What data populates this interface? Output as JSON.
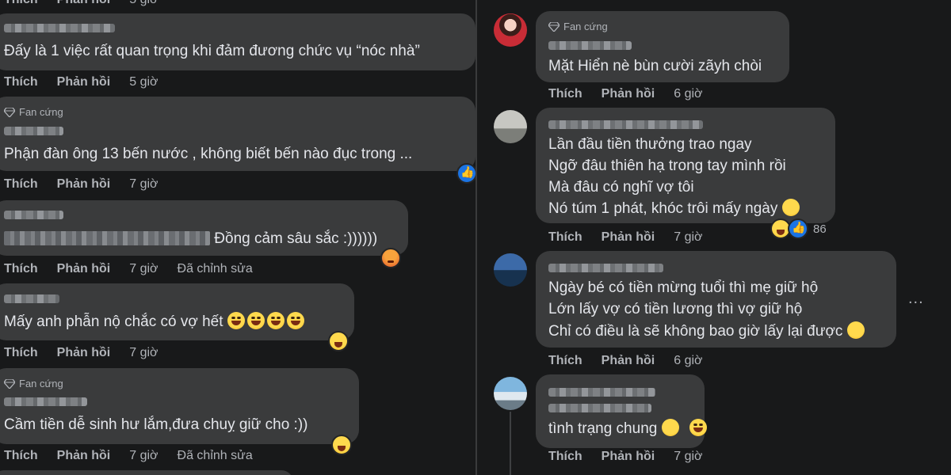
{
  "labels": {
    "like": "Thích",
    "reply": "Phản hồi",
    "edited": "Đã chỉnh sửa",
    "fan_badge": "Fan cứng"
  },
  "left": {
    "top_meta": {
      "time": "5 giờ"
    },
    "comments": [
      {
        "text": "Đấy là 1 việc rất quan trọng khi đảm đương chức vụ “nóc nhà”",
        "time": "5 giờ"
      },
      {
        "text": "Phận đàn ông 13 bến nước , không biết bến nào đục trong ...",
        "time": "7 giờ",
        "reaction": "like"
      },
      {
        "text": "Đồng cảm sâu sắc :))))))",
        "time": "7 giờ",
        "edited": true,
        "reaction": "angry"
      },
      {
        "text": "Mấy anh phẫn nộ chắc có vợ hết",
        "time": "7 giờ",
        "reaction": "haha"
      },
      {
        "text": "Cầm tiền dễ sinh hư lắm,đưa chuỵ giữ cho :))",
        "time": "7 giờ",
        "edited": true,
        "reaction": "haha"
      }
    ]
  },
  "right": {
    "comments": [
      {
        "lines": [
          "Mặt Hiển nè bùn cười zãyh chòi"
        ],
        "time": "6 giờ"
      },
      {
        "lines": [
          "Lần đầu tiền thưởng trao ngay",
          "Ngỡ đâu thiên hạ trong tay mình rồi",
          "Mà đâu có nghĩ vợ tôi",
          "Nó túm 1 phát, khóc trôi mấy ngày"
        ],
        "time": "7 giờ",
        "reaction_count": "86"
      },
      {
        "lines": [
          "Ngày bé có tiền mừng tuổi thì mẹ giữ hộ",
          "Lớn lấy vợ có tiền lương thì vợ giữ hộ",
          "Chỉ có điều là sẽ không bao giờ lấy lại được"
        ],
        "time": "6 giờ"
      },
      {
        "lines": [
          "tình trạng chung"
        ],
        "time": "7 giờ"
      }
    ],
    "more_icon": "..."
  }
}
